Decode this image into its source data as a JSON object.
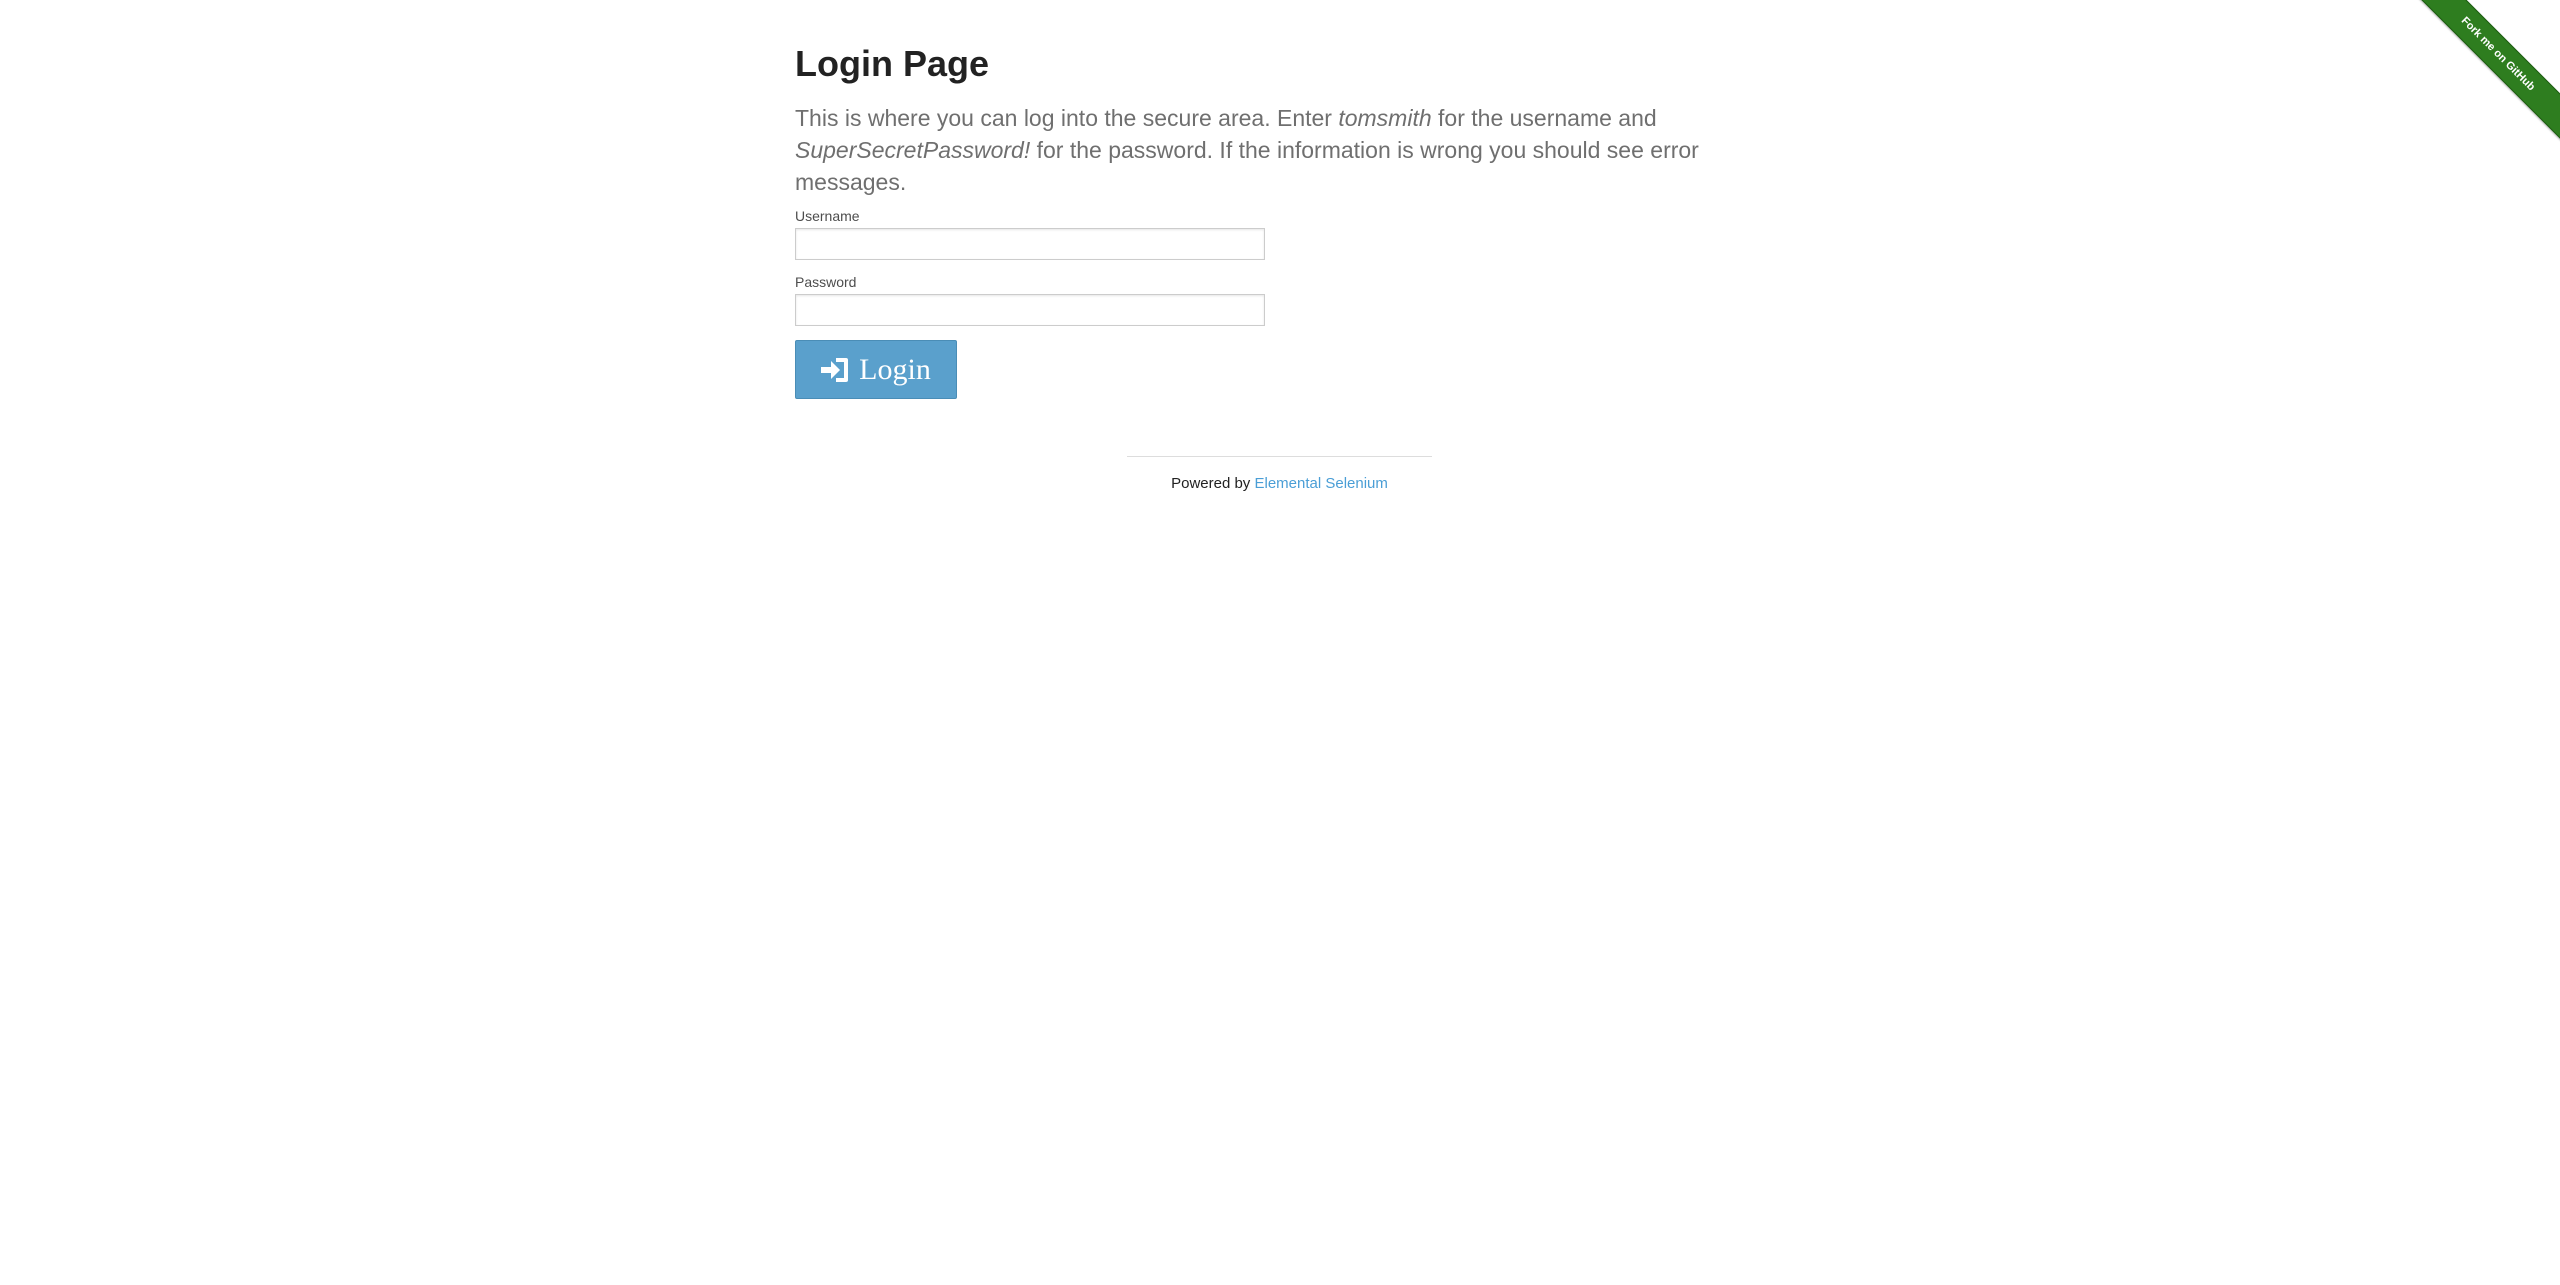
{
  "ribbon": {
    "label": "Fork me on GitHub",
    "color": "#2e7d1f"
  },
  "header": {
    "title": "Login Page"
  },
  "intro": {
    "part1": "This is where you can log into the secure area. Enter ",
    "username_hint": "tomsmith",
    "part2": " for the username and ",
    "password_hint": "SuperSecretPassword!",
    "part3": " for the password. If the information is wrong you should see error messages."
  },
  "form": {
    "username_label": "Username",
    "username_value": "",
    "password_label": "Password",
    "password_value": "",
    "login_label": "Login",
    "login_icon": "sign-in-icon",
    "button_color": "#5aa0cc"
  },
  "footer": {
    "powered_by": "Powered by ",
    "link_text": "Elemental Selenium",
    "link_color": "#4a9ed6"
  }
}
